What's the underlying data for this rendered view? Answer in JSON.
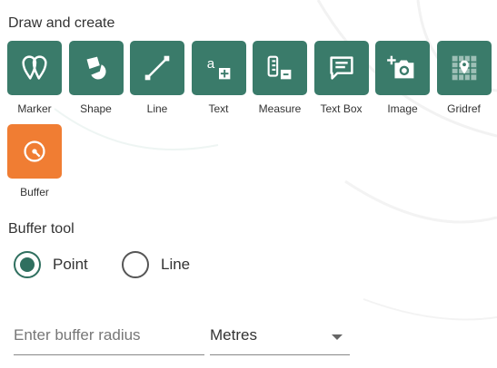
{
  "panel": {
    "title": "Draw and create",
    "tools": [
      {
        "label": "Marker",
        "icon": "marker-icon"
      },
      {
        "label": "Shape",
        "icon": "shape-icon"
      },
      {
        "label": "Line",
        "icon": "line-icon"
      },
      {
        "label": "Text",
        "icon": "text-icon"
      },
      {
        "label": "Measure",
        "icon": "measure-icon"
      },
      {
        "label": "Text Box",
        "icon": "text-box-icon"
      },
      {
        "label": "Image",
        "icon": "image-icon"
      },
      {
        "label": "Gridref",
        "icon": "gridref-icon"
      },
      {
        "label": "Buffer",
        "icon": "buffer-icon",
        "active": true
      }
    ]
  },
  "buffer": {
    "title": "Buffer tool",
    "options": [
      {
        "label": "Point",
        "checked": true
      },
      {
        "label": "Line",
        "checked": false
      }
    ],
    "radius_placeholder": "Enter buffer radius",
    "radius_value": "",
    "unit_selected": "Metres"
  },
  "colors": {
    "tool_bg": "#3a7b6a",
    "tool_active_bg": "#f07d33"
  }
}
